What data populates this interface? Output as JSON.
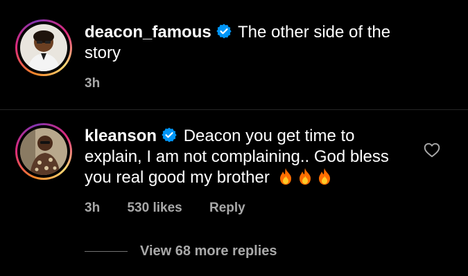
{
  "caption": {
    "username": "deacon_famous",
    "text": "The other side of the story",
    "time": "3h"
  },
  "comment": {
    "username": "kleanson",
    "text": "Deacon you get time to explain, I am not complaining.. God bless you real good my brother",
    "emojis": [
      "🔥",
      "🔥",
      "🔥"
    ],
    "time": "3h",
    "likes": "530 likes",
    "reply_label": "Reply"
  },
  "view_replies": {
    "label": "View 68 more replies"
  },
  "icons": {
    "verified": "verified-badge-icon",
    "like": "heart-icon",
    "emoji": "fire-emoji-icon"
  },
  "colors": {
    "background": "#000000",
    "text": "#ffffff",
    "secondary_text": "#a8a8a8",
    "verified": "#0095f6"
  }
}
